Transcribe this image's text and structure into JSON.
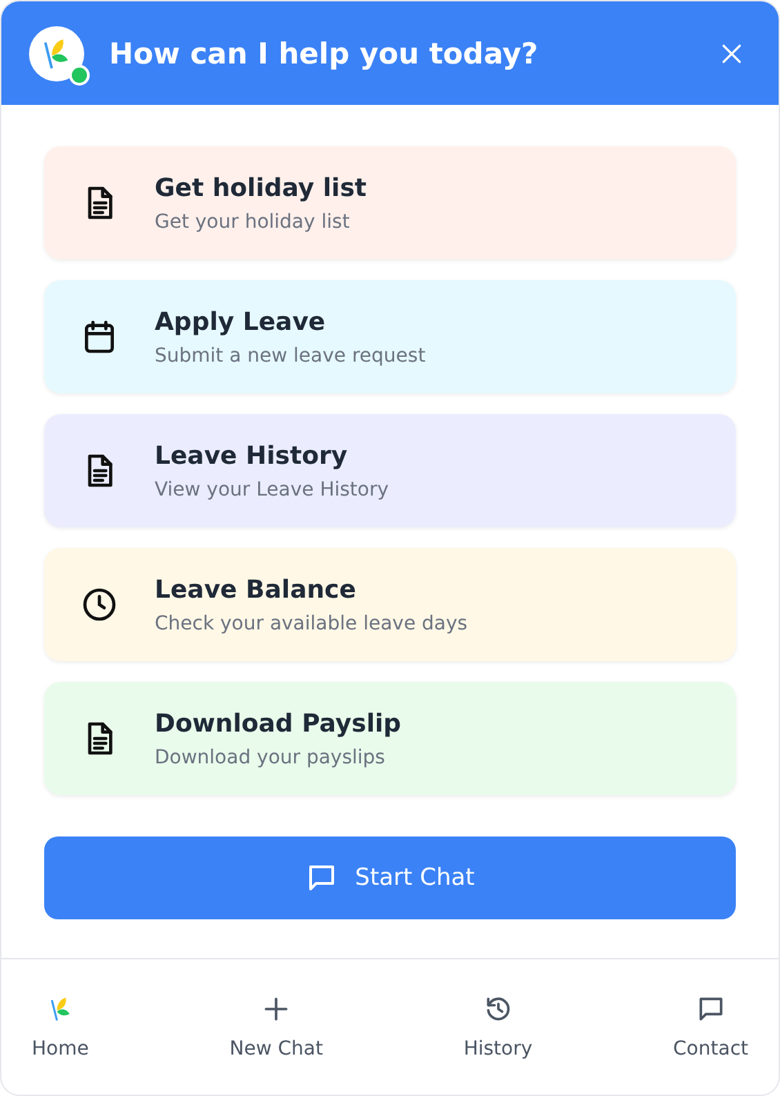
{
  "header": {
    "title": "How can I help you today?",
    "online": true
  },
  "actions": [
    {
      "kind": "document",
      "title": "Get holiday list",
      "subtitle": "Get your holiday list",
      "color": "#fff0eb"
    },
    {
      "kind": "calendar",
      "title": "Apply Leave",
      "subtitle": "Submit a new leave request",
      "color": "#e6f9fe"
    },
    {
      "kind": "document",
      "title": "Leave History",
      "subtitle": "View your Leave History",
      "color": "#ebedfe"
    },
    {
      "kind": "clock",
      "title": "Leave Balance",
      "subtitle": "Check your available leave days",
      "color": "#fff8e6"
    },
    {
      "kind": "document",
      "title": "Download Payslip",
      "subtitle": "Download your payslips",
      "color": "#e9fbeb"
    }
  ],
  "start_button": {
    "label": "Start Chat"
  },
  "nav": [
    {
      "kind": "logo",
      "label": "Home"
    },
    {
      "kind": "plus",
      "label": "New Chat"
    },
    {
      "kind": "history",
      "label": "History"
    },
    {
      "kind": "chat",
      "label": "Contact"
    }
  ]
}
